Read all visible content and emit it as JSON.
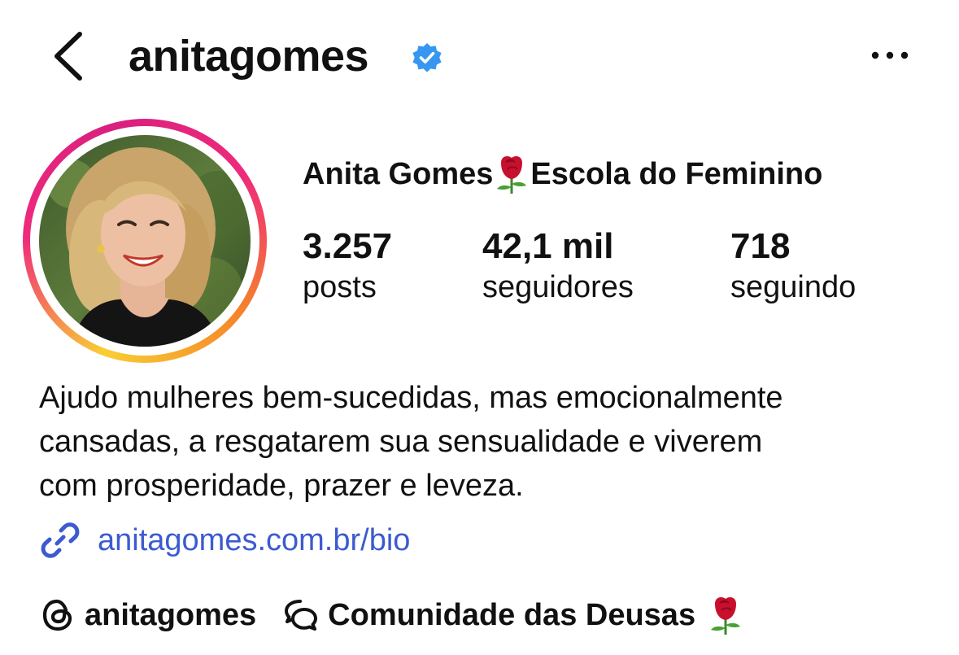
{
  "header": {
    "username": "anitagomes",
    "verified_badge_icon": "verified-badge-icon",
    "back_icon": "chevron-left-icon",
    "more_icon": "more-horizontal-icon"
  },
  "profile": {
    "display_name": "Anita Gomes",
    "display_name_suffix": "Escola do Feminino",
    "name_emoji_icon": "rose-icon"
  },
  "stats": [
    {
      "value": "3.257",
      "label": "posts"
    },
    {
      "value": "42,1 mil",
      "label": "seguidores"
    },
    {
      "value": "718",
      "label": "seguindo"
    }
  ],
  "bio": {
    "lines": [
      "Ajudo mulheres bem-sucedidas, mas emocionalmente",
      "cansadas, a resgatarem sua sensualidade e viverem",
      "com prosperidade, prazer e leveza."
    ]
  },
  "link": {
    "text": "anitagomes.com.br/bio",
    "icon": "link-icon"
  },
  "footer_chips": {
    "threads_label": "anitagomes",
    "threads_icon": "threads-icon",
    "community_label": "Comunidade das Deusas",
    "community_icon": "chat-bubbles-icon"
  },
  "colors": {
    "link": "#3c5bd0",
    "verified": "#3797f0",
    "rose": "#c8102e"
  }
}
